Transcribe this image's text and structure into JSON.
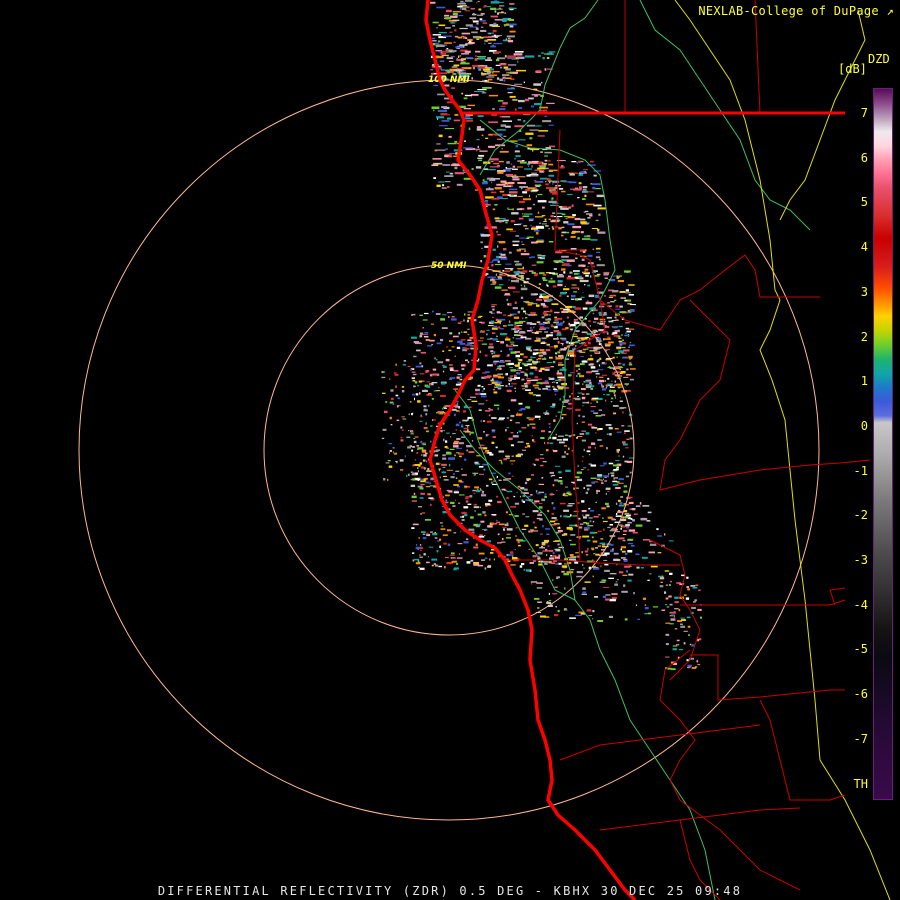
{
  "credit": "NEXLAB-College of DuPage",
  "credit_icon": "diagonal-arrow-icon",
  "product_code": "DZD",
  "units": "[dB]",
  "footer": "DIFFERENTIAL REFLECTIVITY (ZDR) 0.5 DEG - KBHX 30 DEC 25 09:48",
  "range_rings": [
    {
      "label": "50 NMI",
      "range_nmi": 50
    },
    {
      "label": "100 NMI",
      "range_nmi": 100
    }
  ],
  "scale_ticks": [
    "7",
    "6",
    "5",
    "4",
    "3",
    "2",
    "1",
    "0",
    "-1",
    "-2",
    "-3",
    "-4",
    "-5",
    "-6",
    "-7",
    "TH"
  ],
  "colors": {
    "text": "#ffff33",
    "coastline": "#ff0000",
    "state_border": "#ff0000",
    "county_border": "#cc0000",
    "terrain_line": "#3fbf5f",
    "highway_line": "#e0e000",
    "range_ring": "#ffb890"
  }
}
